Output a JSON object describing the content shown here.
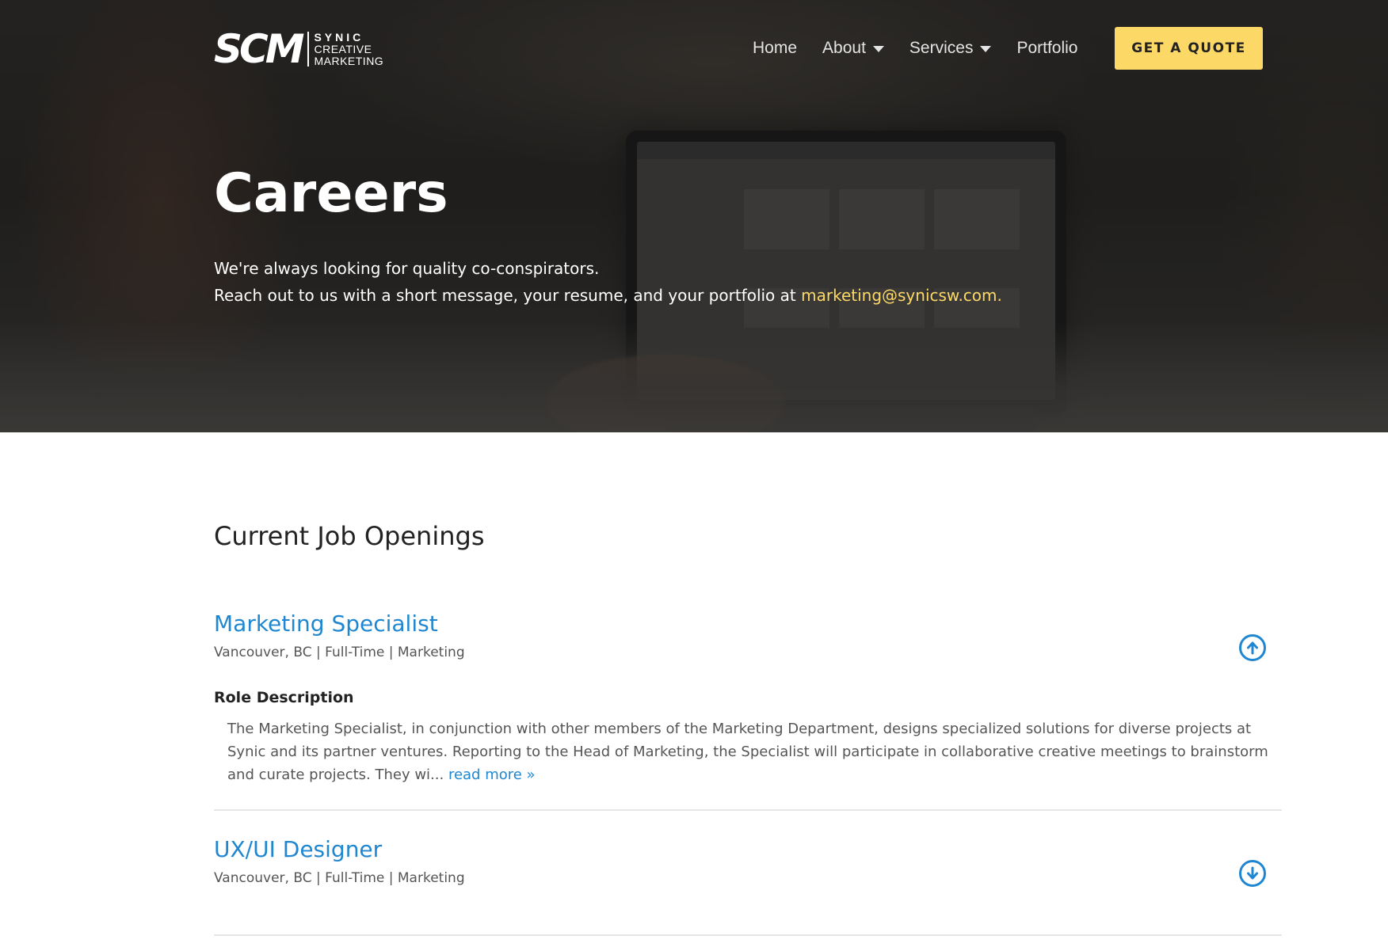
{
  "header": {
    "logo": {
      "mark": "SCM",
      "line1": "SYNIC",
      "line2": "CREATIVE",
      "line3": "MARKETING"
    },
    "nav": [
      {
        "label": "Home",
        "has_dropdown": false
      },
      {
        "label": "About",
        "has_dropdown": true
      },
      {
        "label": "Services",
        "has_dropdown": true
      },
      {
        "label": "Portfolio",
        "has_dropdown": false
      }
    ],
    "quote_button": "GET A QUOTE"
  },
  "hero": {
    "title": "Careers",
    "line1": "We're always looking for quality co-conspirators.",
    "line2_prefix": "Reach out to us with a short message, your resume, and your portfolio at ",
    "email": "marketing@synicsw.com."
  },
  "jobs_section": {
    "title": "Current Job Openings",
    "jobs": [
      {
        "title": "Marketing Specialist",
        "meta": "Vancouver, BC | Full-Time | Marketing",
        "expanded": true,
        "toggle_icon": "arrow-up-circle-icon",
        "role_label": "Role Description",
        "description": "The Marketing Specialist, in conjunction with other members of the Marketing Department, designs specialized solutions for diverse projects at Synic and its partner ventures. Reporting to the Head of Marketing, the Specialist will participate in collaborative creative meetings to brainstorm and curate projects. They wi... ",
        "read_more": "read more »"
      },
      {
        "title": "UX/UI Designer",
        "meta": "Vancouver, BC | Full-Time | Marketing",
        "expanded": false,
        "toggle_icon": "arrow-down-circle-icon"
      }
    ]
  },
  "colors": {
    "accent_yellow": "#fcd967",
    "link_blue": "#1f87d1",
    "text_dark": "#222222",
    "text_muted": "#555555"
  }
}
